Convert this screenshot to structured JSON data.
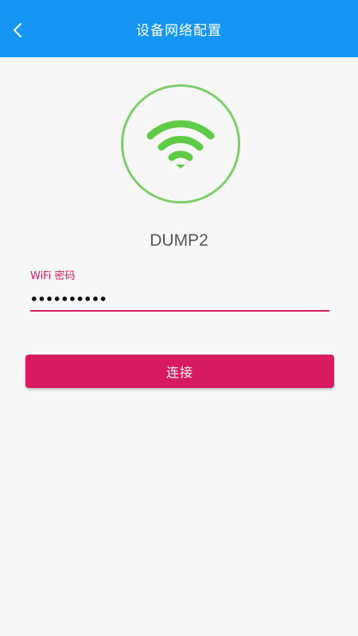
{
  "app_bar": {
    "title": "设备网络配置",
    "background_color": "#1596f5",
    "back_icon": "chevron-left-icon"
  },
  "wifi_graphic": {
    "icon": "wifi-icon",
    "color": "#5fcb47",
    "border_color": "#7dcd6a"
  },
  "device": {
    "name": "DUMP2"
  },
  "password_field": {
    "label": "WiFi 密码",
    "value": "••••••••••",
    "accent_color": "#d81b60"
  },
  "connect_button": {
    "label": "连接",
    "color": "#d81b60"
  }
}
